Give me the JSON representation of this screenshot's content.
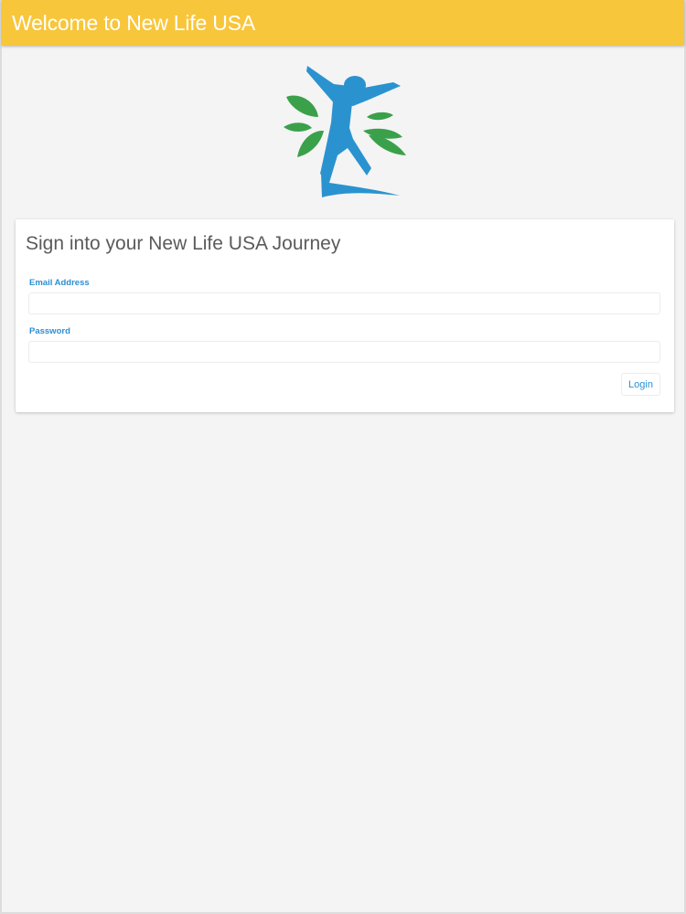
{
  "header": {
    "title": "Welcome to New Life USA",
    "background_color": "#f8c63a"
  },
  "logo": {
    "icon": "person-with-leaves-logo",
    "figure_color": "#2a93cf",
    "leaf_color": "#3aa14a"
  },
  "login_card": {
    "title": "Sign into your New Life USA Journey",
    "email": {
      "label": "Email Address",
      "value": "",
      "placeholder": ""
    },
    "password": {
      "label": "Password",
      "value": "",
      "placeholder": ""
    },
    "login_button_label": "Login",
    "accent_color": "#2b8fd3"
  }
}
